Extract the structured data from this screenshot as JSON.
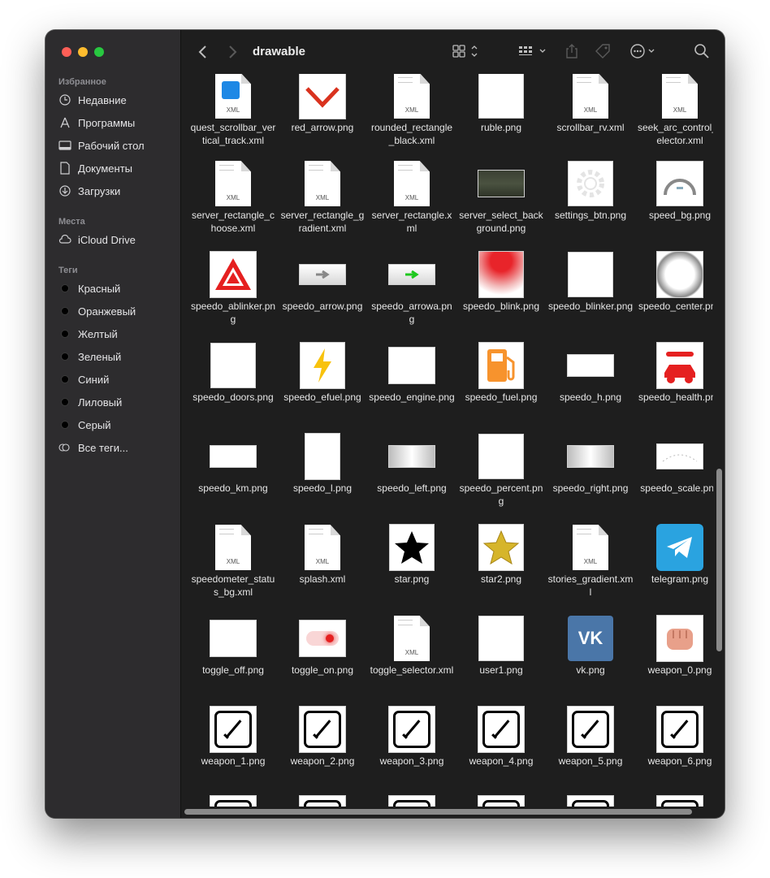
{
  "window": {
    "title": "drawable"
  },
  "sidebar": {
    "favorites_label": "Избранное",
    "favorites": [
      {
        "label": "Недавние",
        "icon": "clock-icon"
      },
      {
        "label": "Программы",
        "icon": "apps-icon"
      },
      {
        "label": "Рабочий стол",
        "icon": "desktop-icon"
      },
      {
        "label": "Документы",
        "icon": "document-icon"
      },
      {
        "label": "Загрузки",
        "icon": "download-icon"
      }
    ],
    "places_label": "Места",
    "places": [
      {
        "label": "iCloud Drive",
        "icon": "cloud-icon"
      }
    ],
    "tags_label": "Теги",
    "tags": [
      {
        "label": "Красный"
      },
      {
        "label": "Оранжевый"
      },
      {
        "label": "Желтый"
      },
      {
        "label": "Зеленый"
      },
      {
        "label": "Синий"
      },
      {
        "label": "Лиловый"
      },
      {
        "label": "Серый"
      },
      {
        "label": "Все теги..."
      }
    ]
  },
  "files": [
    [
      {
        "name": "quest_scrollbar_vertical_track.xml",
        "kind": "xml-blue"
      },
      {
        "name": "red_arrow.png",
        "kind": "red-arrow"
      },
      {
        "name": "rounded_rectangle_black.xml",
        "kind": "xml"
      },
      {
        "name": "ruble.png",
        "kind": "white-square"
      },
      {
        "name": "scrollbar_rv.xml",
        "kind": "xml"
      },
      {
        "name": "seek_arc_control_selector.xml",
        "kind": "xml"
      }
    ],
    [
      {
        "name": "server_rectangle_choose.xml",
        "kind": "xml"
      },
      {
        "name": "server_rectangle_gradient.xml",
        "kind": "xml"
      },
      {
        "name": "server_rectangle.xml",
        "kind": "xml"
      },
      {
        "name": "server_select_background.png",
        "kind": "landscape"
      },
      {
        "name": "settings_btn.png",
        "kind": "gear"
      },
      {
        "name": "speed_bg.png",
        "kind": "gauge"
      }
    ],
    [
      {
        "name": "speedo_ablinker.png",
        "kind": "hazard"
      },
      {
        "name": "speedo_arrow.png",
        "kind": "arrow-gray"
      },
      {
        "name": "speedo_arrowa.png",
        "kind": "arrow-green"
      },
      {
        "name": "speedo_blink.png",
        "kind": "red-gradient"
      },
      {
        "name": "speedo_blinker.png",
        "kind": "white-square"
      },
      {
        "name": "speedo_center.png",
        "kind": "radial"
      }
    ],
    [
      {
        "name": "speedo_doors.png",
        "kind": "white-square"
      },
      {
        "name": "speedo_efuel.png",
        "kind": "bolt"
      },
      {
        "name": "speedo_engine.png",
        "kind": "white-wide"
      },
      {
        "name": "speedo_fuel.png",
        "kind": "fuel"
      },
      {
        "name": "speedo_h.png",
        "kind": "white-strip"
      },
      {
        "name": "speedo_health.png",
        "kind": "car-repair"
      }
    ],
    [
      {
        "name": "speedo_km.png",
        "kind": "white-strip"
      },
      {
        "name": "speedo_l.png",
        "kind": "white-tall"
      },
      {
        "name": "speedo_left.png",
        "kind": "gray-strip"
      },
      {
        "name": "speedo_percent.png",
        "kind": "white-square"
      },
      {
        "name": "speedo_right.png",
        "kind": "gray-strip"
      },
      {
        "name": "speedo_scale.png",
        "kind": "scale"
      }
    ],
    [
      {
        "name": "speedometer_status_bg.xml",
        "kind": "xml"
      },
      {
        "name": "splash.xml",
        "kind": "xml"
      },
      {
        "name": "star.png",
        "kind": "star-black"
      },
      {
        "name": "star2.png",
        "kind": "star-gold"
      },
      {
        "name": "stories_gradient.xml",
        "kind": "xml"
      },
      {
        "name": "telegram.png",
        "kind": "telegram"
      }
    ],
    [
      {
        "name": "toggle_off.png",
        "kind": "white-wide"
      },
      {
        "name": "toggle_on.png",
        "kind": "toggle-on"
      },
      {
        "name": "toggle_selector.xml",
        "kind": "xml"
      },
      {
        "name": "user1.png",
        "kind": "white-square"
      },
      {
        "name": "vk.png",
        "kind": "vk"
      },
      {
        "name": "weapon_0.png",
        "kind": "fist"
      }
    ],
    [
      {
        "name": "weapon_1.png",
        "kind": "weapon"
      },
      {
        "name": "weapon_2.png",
        "kind": "weapon"
      },
      {
        "name": "weapon_3.png",
        "kind": "weapon"
      },
      {
        "name": "weapon_4.png",
        "kind": "weapon"
      },
      {
        "name": "weapon_5.png",
        "kind": "weapon"
      },
      {
        "name": "weapon_6.png",
        "kind": "weapon"
      }
    ]
  ],
  "colors": {
    "sidebar_bg": "#2d2c2e",
    "content_bg": "#1e1e1e",
    "traffic_red": "#ff5f57",
    "traffic_yellow": "#febc2e",
    "traffic_green": "#28c840"
  }
}
